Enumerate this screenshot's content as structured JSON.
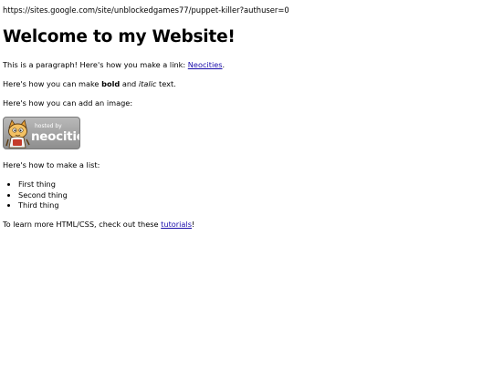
{
  "address": "https://sites.google.com/site/unblockedgames77/puppet-killer?authuser=0",
  "heading": "Welcome to my Website!",
  "para1": {
    "before": "This is a paragraph! Here's how you make a link: ",
    "link": "Neocities",
    "after": "."
  },
  "para2": {
    "before": "Here's how you can make ",
    "bold": "bold",
    "middle": " and ",
    "italic": "italic",
    "after": " text."
  },
  "para3": "Here's how you can add an image:",
  "badge": {
    "small": "hosted by",
    "big": "neocities"
  },
  "para4": "Here's how to make a list:",
  "list": [
    "First thing",
    "Second thing",
    "Third thing"
  ],
  "para5": {
    "before": "To learn more HTML/CSS, check out these ",
    "link": "tutorials",
    "after": "!"
  }
}
